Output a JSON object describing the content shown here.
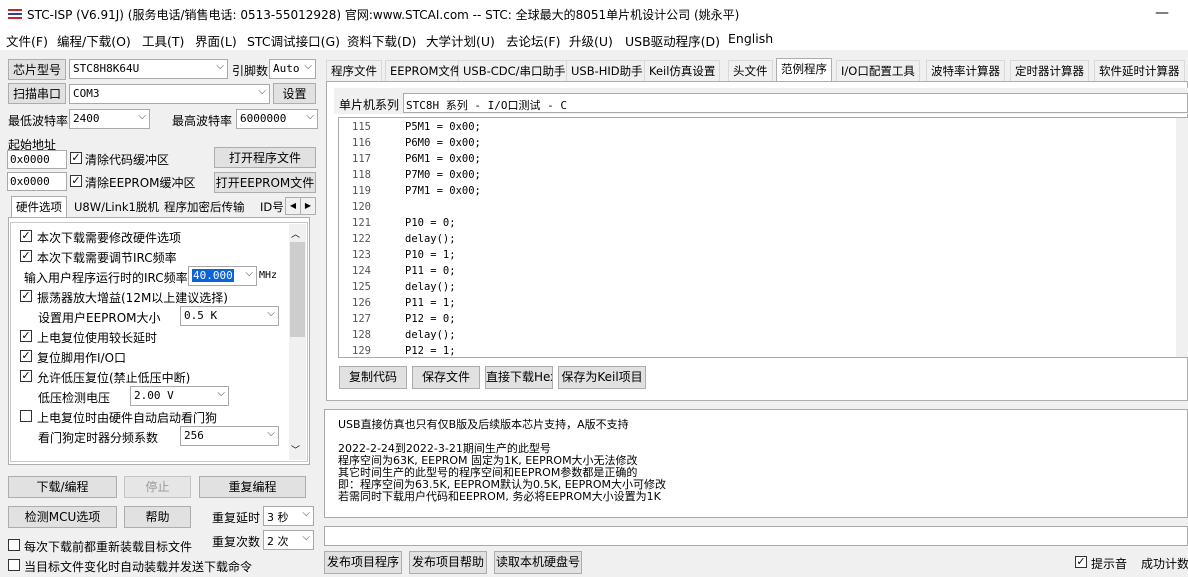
{
  "window": {
    "title": "STC-ISP (V6.91J) (服务电话/销售电话: 0513-55012928) 官网:www.STCAI.com  -- STC: 全球最大的8051单片机设计公司 (姚永平)",
    "minimize": "—"
  },
  "menu": [
    "文件(F)",
    "编程/下载(O)",
    "工具(T)",
    "界面(L)",
    "STC调试接口(G)",
    "资料下载(D)",
    "大学计划(U)",
    "去论坛(F)",
    "升级(U)",
    "USB驱动程序(D)",
    "English"
  ],
  "left": {
    "chip_type_button": "芯片型号",
    "chip_type_value": "STC8H8K64U",
    "pins_label": "引脚数",
    "pins_value": "Auto",
    "scan_port_button": "扫描串口",
    "port_value": "COM3",
    "settings_button": "设置",
    "min_baud_label": "最低波特率",
    "min_baud_value": "2400",
    "max_baud_label": "最高波特率",
    "max_baud_value": "6000000",
    "start_addr_label": "起始地址",
    "addr1_value": "0x0000",
    "clear_code_label": "清除代码缓冲区",
    "open_program_button": "打开程序文件",
    "addr2_value": "0x0000",
    "clear_eeprom_label": "清除EEPROM缓冲区",
    "open_eeprom_button": "打开EEPROM文件",
    "tabs": [
      "硬件选项",
      "U8W/Link1脱机",
      "程序加密后传输",
      "ID号"
    ],
    "hw_options": {
      "opt1": "本次下载需要修改硬件选项",
      "opt2": "本次下载需要调节IRC频率",
      "irc_label": "输入用户程序运行时的IRC频率",
      "irc_value": "40.000",
      "irc_unit": "MHz",
      "opt3": "振荡器放大增益(12M以上建议选择)",
      "eeprom_size_label": "设置用户EEPROM大小",
      "eeprom_size_value": "0.5 K",
      "opt4": "上电复位使用较长延时",
      "opt5": "复位脚用作I/O口",
      "opt6": "允许低压复位(禁止低压中断)",
      "lvd_label": "低压检测电压",
      "lvd_value": "2.00 V",
      "opt7": "上电复位时由硬件自动启动看门狗",
      "wdt_label": "看门狗定时器分频系数",
      "wdt_value": "256"
    },
    "download_button": "下载/编程",
    "stop_button": "停止",
    "reprogram_button": "重复编程",
    "detect_mcu_button": "检测MCU选项",
    "help_button": "帮助",
    "repeat_delay_label": "重复延时",
    "repeat_delay_value": "3 秒",
    "repeat_count_label": "重复次数",
    "repeat_count_value": "2 次",
    "reload_each_label": "每次下载前都重新装载目标文件",
    "auto_load_label": "当目标文件变化时自动装载并发送下载命令"
  },
  "right": {
    "tabs": [
      "程序文件",
      "EEPROM文件",
      "USB-CDC/串口助手",
      "USB-HID助手",
      "Keil仿真设置",
      "头文件",
      "范例程序",
      "I/O口配置工具",
      "波特率计算器",
      "定时器计算器",
      "软件延时计算器"
    ],
    "active_tab": "范例程序",
    "series_label": "单片机系列",
    "series_value": "STC8H 系列 - I/O口测试 - C",
    "code_lines": [
      {
        "n": "115",
        "t": "P5M1 = 0x00;"
      },
      {
        "n": "116",
        "t": "P6M0 = 0x00;"
      },
      {
        "n": "117",
        "t": "P6M1 = 0x00;"
      },
      {
        "n": "118",
        "t": "P7M0 = 0x00;"
      },
      {
        "n": "119",
        "t": "P7M1 = 0x00;"
      },
      {
        "n": "120",
        "t": ""
      },
      {
        "n": "121",
        "t": "P10 = 0;"
      },
      {
        "n": "122",
        "t": "delay();"
      },
      {
        "n": "123",
        "t": "P10 = 1;"
      },
      {
        "n": "124",
        "t": "P11 = 0;"
      },
      {
        "n": "125",
        "t": "delay();"
      },
      {
        "n": "126",
        "t": "P11 = 1;"
      },
      {
        "n": "127",
        "t": "P12 = 0;"
      },
      {
        "n": "128",
        "t": "delay();"
      },
      {
        "n": "129",
        "t": "P12 = 1;"
      }
    ],
    "copy_code_button": "复制代码",
    "save_file_button": "保存文件",
    "download_hex_button": "直接下载Hex",
    "save_keil_button": "保存为Keil项目",
    "info_lines": [
      "USB直接仿真也只有仅B版及后续版本芯片支持，A版不支持",
      "",
      "2022-2-24到2022-3-21期间生产的此型号",
      "程序空间为63K, EEPROM 固定为1K, EEPROM大小无法修改",
      "其它时间生产的此型号的程序空间和EEPROM参数都是正确的",
      "即：程序空间为63.5K, EEPROM默认为0.5K, EEPROM大小可修改",
      "若需同时下载用户代码和EEPROM, 务必将EEPROM大小设置为1K"
    ],
    "publish_program_button": "发布项目程序",
    "publish_help_button": "发布项目帮助",
    "read_disk_button": "读取本机硬盘号",
    "sound_label": "提示音",
    "success_count_label": "成功计数"
  }
}
